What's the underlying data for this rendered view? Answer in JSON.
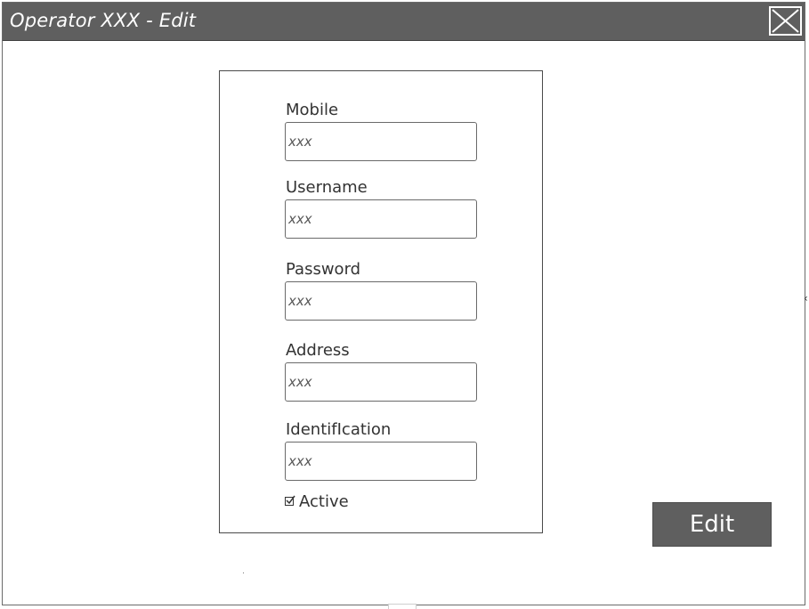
{
  "window": {
    "title": "Operator XXX - Edit"
  },
  "icons": {
    "close": "close-icon",
    "checkbox": "checkmark-icon"
  },
  "form": {
    "fields": [
      {
        "label": "Mobile",
        "value": "xxx"
      },
      {
        "label": "Username",
        "value": "xxx"
      },
      {
        "label": "Password",
        "value": "xxx"
      },
      {
        "label": "Address",
        "value": "xxx"
      },
      {
        "label": "IdentifIcation",
        "value": "xxx"
      }
    ],
    "active": {
      "label": "Active",
      "checked": true
    }
  },
  "actions": {
    "edit_label": "Edit"
  },
  "colors": {
    "titlebar": "#5f5f5f",
    "button": "#5f5f5f",
    "text": "#333333",
    "background": "#ffffff"
  }
}
